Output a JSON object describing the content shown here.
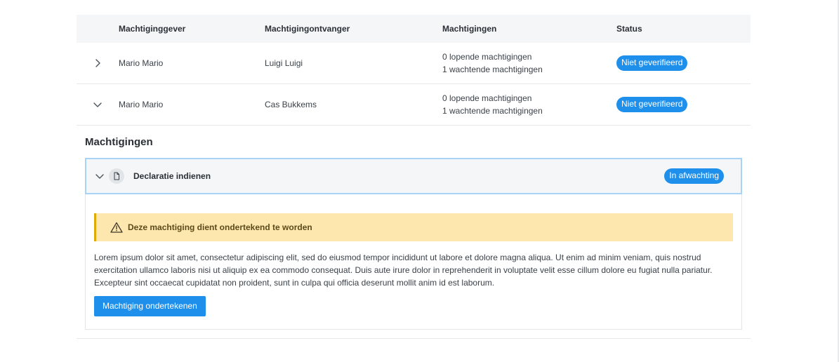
{
  "table": {
    "headers": [
      "Machtiginggever",
      "Machtigingontvanger",
      "Machtigingen",
      "Status"
    ],
    "rows": [
      {
        "giver": "Mario Mario",
        "receiver": "Luigi Luigi",
        "running": "0 lopende machtigingen",
        "waiting": "1 wachtende machtigingen",
        "status": "Niet geverifieerd",
        "expanded": false
      },
      {
        "giver": "Mario Mario",
        "receiver": "Cas Bukkems",
        "running": "0 lopende machtigingen",
        "waiting": "1 wachtende machtigingen",
        "status": "Niet geverifieerd",
        "expanded": true
      }
    ]
  },
  "detail": {
    "section_title": "Machtigingen",
    "panel": {
      "title": "Declaratie indienen",
      "status": "In afwachting",
      "alert": "Deze machtiging dient ondertekend te worden",
      "body": "Lorem ipsum dolor sit amet, consectetur adipiscing elit, sed do eiusmod tempor incididunt ut labore et dolore magna aliqua. Ut enim ad minim veniam, quis nostrud exercitation ullamco laboris nisi ut aliquip ex ea commodo consequat. Duis aute irure dolor in reprehenderit in voluptate velit esse cillum dolore eu fugiat nulla pariatur. Excepteur sint occaecat cupidatat non proident, sunt in culpa qui officia deserunt mollit anim id est laborum.",
      "button": "Machtiging ondertekenen"
    }
  },
  "colors": {
    "accent": "#1e90ec",
    "warning_bg": "#fde7ae",
    "warning_border": "#e0a800",
    "header_bg": "#f5f6f8"
  },
  "icons": {
    "collapsed": "chevron-right-icon",
    "expanded": "chevron-down-icon",
    "document": "document-icon",
    "warning": "warning-icon"
  }
}
